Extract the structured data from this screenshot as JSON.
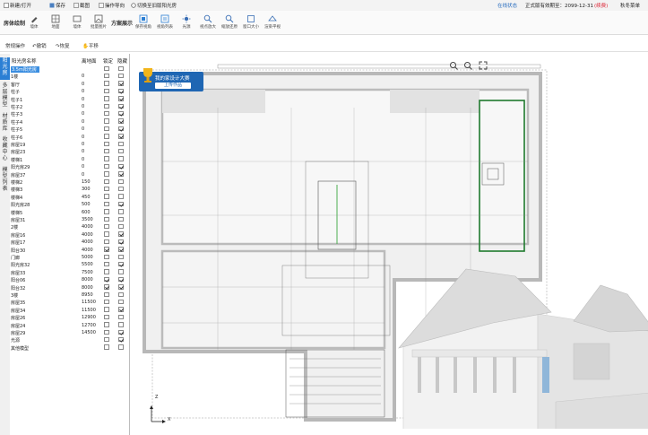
{
  "menu": {
    "new_open": "新建/打开",
    "save": "保存",
    "image": "截图",
    "guide": "操作导向",
    "switch": "切换至旧版阳光房"
  },
  "status": {
    "online": "在线状态",
    "expiry_label": "正式版有效期至：2099-12-31",
    "renew": "(续费)",
    "user": "秋冬菜单"
  },
  "ribbon": {
    "group_drawing": "房体绘制",
    "group_scheme": "方案展示",
    "tools_left": [
      "墙体",
      "地面",
      "墙体",
      "批量图片"
    ],
    "tools_right": [
      "保存视角",
      "视角列表",
      "光源",
      "视点放大",
      "缩放还原",
      "窗口大小",
      "渲染平视"
    ]
  },
  "subbar": {
    "normal_op": "常规操作",
    "undo": "撤销",
    "redo": "恢复",
    "pan": "平移"
  },
  "vtabs": [
    "阳光房",
    "多层模型",
    "材质库",
    "收藏中心",
    "模型列表"
  ],
  "list": {
    "headers": {
      "name": "阳光房名称",
      "height": "离地面",
      "lock": "锁定",
      "hide": "隐藏"
    },
    "rows": [
      {
        "name": "3.5m阳光房",
        "height": "",
        "lock": false,
        "hide": false,
        "selected": true
      },
      {
        "name": "1楼",
        "height": "0",
        "lock": false,
        "hide": false
      },
      {
        "name": "客厅",
        "height": "0",
        "lock": false,
        "hide": true
      },
      {
        "name": "柱子",
        "height": "0",
        "lock": false,
        "hide": true
      },
      {
        "name": "柱子1",
        "height": "0",
        "lock": false,
        "hide": true
      },
      {
        "name": "柱子2",
        "height": "0",
        "lock": false,
        "hide": true
      },
      {
        "name": "柱子3",
        "height": "0",
        "lock": false,
        "hide": true
      },
      {
        "name": "柱子4",
        "height": "0",
        "lock": false,
        "hide": true
      },
      {
        "name": "柱子5",
        "height": "0",
        "lock": false,
        "hide": true
      },
      {
        "name": "柱子6",
        "height": "0",
        "lock": false,
        "hide": true
      },
      {
        "name": "房屋19",
        "height": "0",
        "lock": false,
        "hide": false
      },
      {
        "name": "房屋23",
        "height": "0",
        "lock": false,
        "hide": false
      },
      {
        "name": "楼梯1",
        "height": "0",
        "lock": false,
        "hide": false
      },
      {
        "name": "阳光房29",
        "height": "0",
        "lock": false,
        "hide": true
      },
      {
        "name": "房屋37",
        "height": "0",
        "lock": false,
        "hide": true
      },
      {
        "name": "楼梯2",
        "height": "150",
        "lock": false,
        "hide": false
      },
      {
        "name": "楼梯3",
        "height": "300",
        "lock": false,
        "hide": false
      },
      {
        "name": "楼梯4",
        "height": "450",
        "lock": false,
        "hide": false
      },
      {
        "name": "阳光房28",
        "height": "500",
        "lock": false,
        "hide": true
      },
      {
        "name": "楼梯5",
        "height": "600",
        "lock": false,
        "hide": false
      },
      {
        "name": "房屋31",
        "height": "3500",
        "lock": false,
        "hide": false
      },
      {
        "name": "2楼",
        "height": "4000",
        "lock": false,
        "hide": false
      },
      {
        "name": "房屋16",
        "height": "4000",
        "lock": false,
        "hide": true
      },
      {
        "name": "房屋17",
        "height": "4000",
        "lock": false,
        "hide": true
      },
      {
        "name": "阳台30",
        "height": "4000",
        "lock": true,
        "hide": true
      },
      {
        "name": "门廊",
        "height": "5000",
        "lock": false,
        "hide": false
      },
      {
        "name": "阳光房32",
        "height": "5500",
        "lock": false,
        "hide": true
      },
      {
        "name": "房屋33",
        "height": "7500",
        "lock": false,
        "hide": false
      },
      {
        "name": "阳台06",
        "height": "8000",
        "lock": true,
        "hide": true
      },
      {
        "name": "阳台32",
        "height": "8000",
        "lock": true,
        "hide": true
      },
      {
        "name": "3楼",
        "height": "8950",
        "lock": false,
        "hide": false
      },
      {
        "name": "房屋35",
        "height": "11500",
        "lock": false,
        "hide": false
      },
      {
        "name": "房屋34",
        "height": "11500",
        "lock": false,
        "hide": true
      },
      {
        "name": "房屋26",
        "height": "12900",
        "lock": false,
        "hide": false
      },
      {
        "name": "房屋24",
        "height": "12700",
        "lock": false,
        "hide": false
      },
      {
        "name": "房屋29",
        "height": "14500",
        "lock": false,
        "hide": true
      },
      {
        "name": "光源",
        "height": "",
        "lock": false,
        "hide": true
      },
      {
        "name": "其他模型",
        "height": "",
        "lock": false,
        "hide": false
      }
    ]
  },
  "canvas": {
    "promo_title": "我的家设计大赛",
    "promo_button": "上传作品",
    "axis_z": "Z",
    "axis_x": "X"
  },
  "colors": {
    "accent": "#2b7fd4",
    "promo_bg": "#1f66b3",
    "wall": "#bfbfbf",
    "highlight_wall": "#1f7a2e",
    "blueprint_line": "#4a4a4a"
  }
}
